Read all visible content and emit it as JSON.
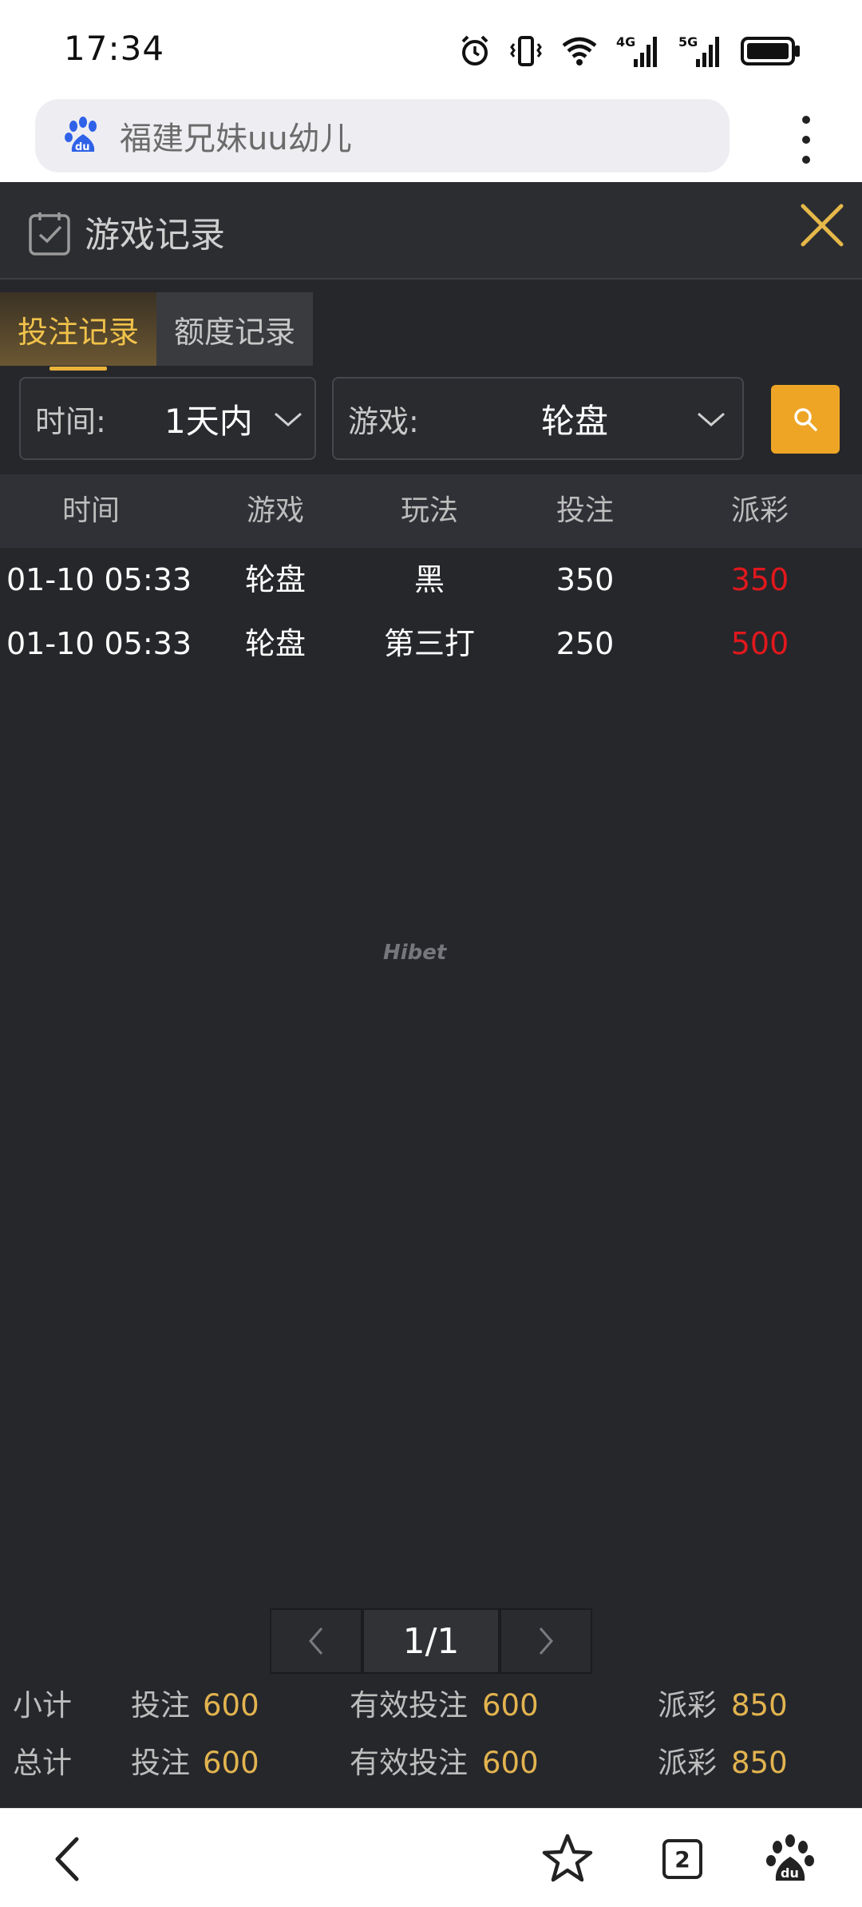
{
  "status_bar": {
    "time": "17:34",
    "net1": "4G",
    "net2": "5G"
  },
  "browser": {
    "url_text": "福建兄妹uu幼儿",
    "tabs_count": "2"
  },
  "dialog": {
    "title": "游戏记录",
    "tabs": [
      {
        "label": "投注记录",
        "active": true
      },
      {
        "label": "额度记录",
        "active": false
      }
    ],
    "filters": {
      "time_label": "时间:",
      "time_value": "1天内",
      "game_label": "游戏:",
      "game_value": "轮盘"
    },
    "table": {
      "headers": [
        "时间",
        "游戏",
        "玩法",
        "投注",
        "派彩"
      ],
      "rows": [
        {
          "time": "01-10 05:33",
          "game": "轮盘",
          "play": "黑",
          "bet": "350",
          "payout": "350"
        },
        {
          "time": "01-10 05:33",
          "game": "轮盘",
          "play": "第三打",
          "bet": "250",
          "payout": "500"
        }
      ]
    },
    "watermark": "Hibet",
    "pagination": {
      "page": "1/1"
    },
    "totals": {
      "subtotal": {
        "label": "小计",
        "bet_label": "投注",
        "bet": "600",
        "valid_label": "有效投注",
        "valid": "600",
        "payout_label": "派彩",
        "payout": "850"
      },
      "total": {
        "label": "总计",
        "bet_label": "投注",
        "bet": "600",
        "valid_label": "有效投注",
        "valid": "600",
        "payout_label": "派彩",
        "payout": "850"
      }
    }
  },
  "colors": {
    "accent": "#eea526",
    "win": "#e0181d",
    "panel": "#26272b",
    "gold_text": "#e2b44f"
  }
}
